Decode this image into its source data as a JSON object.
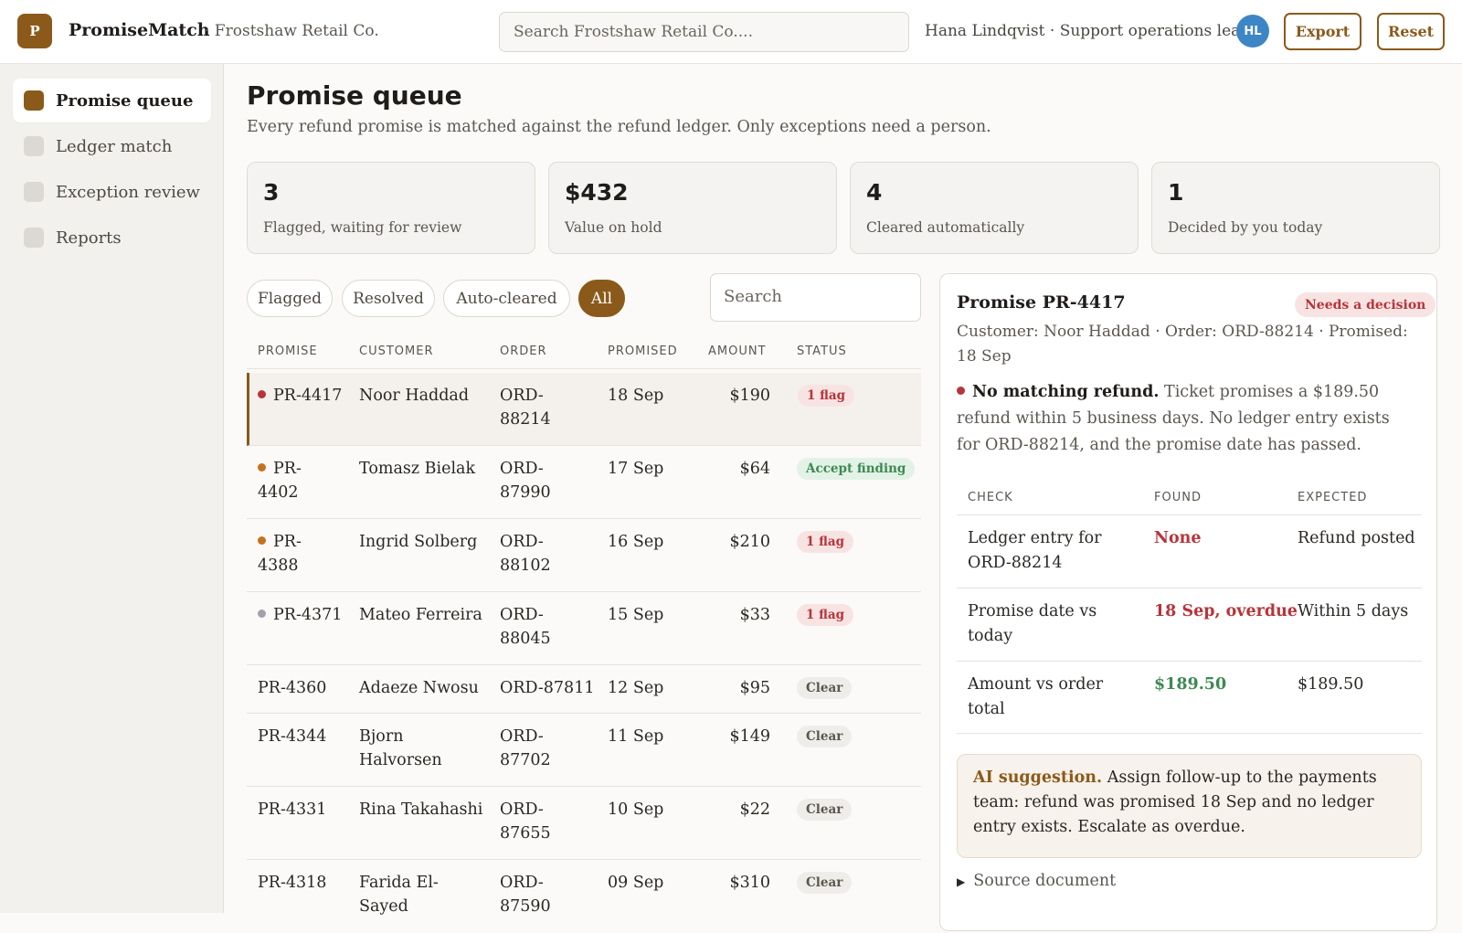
{
  "header": {
    "logo_letter": "P",
    "brand": "PromiseMatch",
    "org": "· Frostshaw Retail Co.",
    "search_placeholder": "Search Frostshaw Retail Co....",
    "user": "Hana Lindqvist · Support operations lead",
    "avatar_initials": "HL",
    "export_label": "Export",
    "reset_label": "Reset"
  },
  "sidebar": {
    "items": [
      {
        "label": "Promise queue",
        "active": true
      },
      {
        "label": "Ledger match",
        "active": false
      },
      {
        "label": "Exception review",
        "active": false
      },
      {
        "label": "Reports",
        "active": false
      }
    ]
  },
  "page": {
    "title": "Promise queue",
    "subtitle": "Every refund promise is matched against the refund ledger. Only exceptions need a person."
  },
  "kpis": [
    {
      "value": "3",
      "label": "Flagged, waiting for review"
    },
    {
      "value": "$432",
      "label": "Value on hold"
    },
    {
      "value": "4",
      "label": "Cleared automatically"
    },
    {
      "value": "1",
      "label": "Decided by you today"
    }
  ],
  "filters": {
    "chips": [
      {
        "label": "Flagged",
        "active": false
      },
      {
        "label": "Resolved",
        "active": false
      },
      {
        "label": "Auto-cleared",
        "active": false
      },
      {
        "label": "All",
        "active": true
      }
    ],
    "search_placeholder": "Search"
  },
  "table": {
    "columns": [
      "PROMISE",
      "CUSTOMER",
      "ORDER",
      "PROMISED",
      "AMOUNT",
      "STATUS"
    ],
    "rows": [
      {
        "promise": "PR-4417",
        "dot": "#b8343a",
        "customer": "Noor Haddad",
        "order": "ORD-88214",
        "promised": "18 Sep",
        "amount": "$190",
        "status": "1 flag",
        "status_type": "flag",
        "selected": true
      },
      {
        "promise": "PR-4402",
        "dot": "#c7711f",
        "customer": "Tomasz Bielak",
        "order": "ORD-87990",
        "promised": "17 Sep",
        "amount": "$64",
        "status": "Accept finding",
        "status_type": "accept",
        "selected": false
      },
      {
        "promise": "PR-4388",
        "dot": "#c7711f",
        "customer": "Ingrid Solberg",
        "order": "ORD-88102",
        "promised": "16 Sep",
        "amount": "$210",
        "status": "1 flag",
        "status_type": "flag",
        "selected": false
      },
      {
        "promise": "PR-4371",
        "dot": "#a4a1ad",
        "customer": "Mateo Ferreira",
        "order": "ORD-88045",
        "promised": "15 Sep",
        "amount": "$33",
        "status": "1 flag",
        "status_type": "flag",
        "selected": false
      },
      {
        "promise": "PR-4360",
        "dot": "",
        "customer": "Adaeze Nwosu",
        "order": "ORD-87811",
        "promised": "12 Sep",
        "amount": "$95",
        "status": "Clear",
        "status_type": "clear",
        "selected": false
      },
      {
        "promise": "PR-4344",
        "dot": "",
        "customer": "Bjorn Halvorsen",
        "order": "ORD-87702",
        "promised": "11 Sep",
        "amount": "$149",
        "status": "Clear",
        "status_type": "clear",
        "selected": false
      },
      {
        "promise": "PR-4331",
        "dot": "",
        "customer": "Rina Takahashi",
        "order": "ORD-87655",
        "promised": "10 Sep",
        "amount": "$22",
        "status": "Clear",
        "status_type": "clear",
        "selected": false
      },
      {
        "promise": "PR-4318",
        "dot": "",
        "customer": "Farida El-Sayed",
        "order": "ORD-87590",
        "promised": "09 Sep",
        "amount": "$310",
        "status": "Clear",
        "status_type": "clear",
        "selected": false
      }
    ]
  },
  "detail": {
    "title": "Promise PR-4417",
    "badge": "Needs a decision",
    "meta": "Customer: Noor Haddad · Order: ORD-88214 · Promised: 18 Sep",
    "finding_title": "No matching refund.",
    "finding_text": "Ticket promises a $189.50 refund within 5 business days. No ledger entry exists for ORD-88214, and the promise date has passed.",
    "finding_dot": "#b8343a",
    "check_columns": [
      "CHECK",
      "FOUND",
      "EXPECTED"
    ],
    "checks": [
      {
        "check": "Ledger entry for ORD-88214",
        "found": "None",
        "found_tone": "red",
        "expected": "Refund posted"
      },
      {
        "check": "Promise date vs today",
        "found": "18 Sep, overdue",
        "found_tone": "red",
        "expected": "Within 5 days"
      },
      {
        "check": "Amount vs order total",
        "found": "$189.50",
        "found_tone": "green",
        "expected": "$189.50"
      }
    ],
    "ai_title": "AI suggestion.",
    "ai_text": "Assign follow-up to the payments team: refund was promised 18 Sep and no ledger entry exists. Escalate as overdue.",
    "source_label": "Source document"
  }
}
